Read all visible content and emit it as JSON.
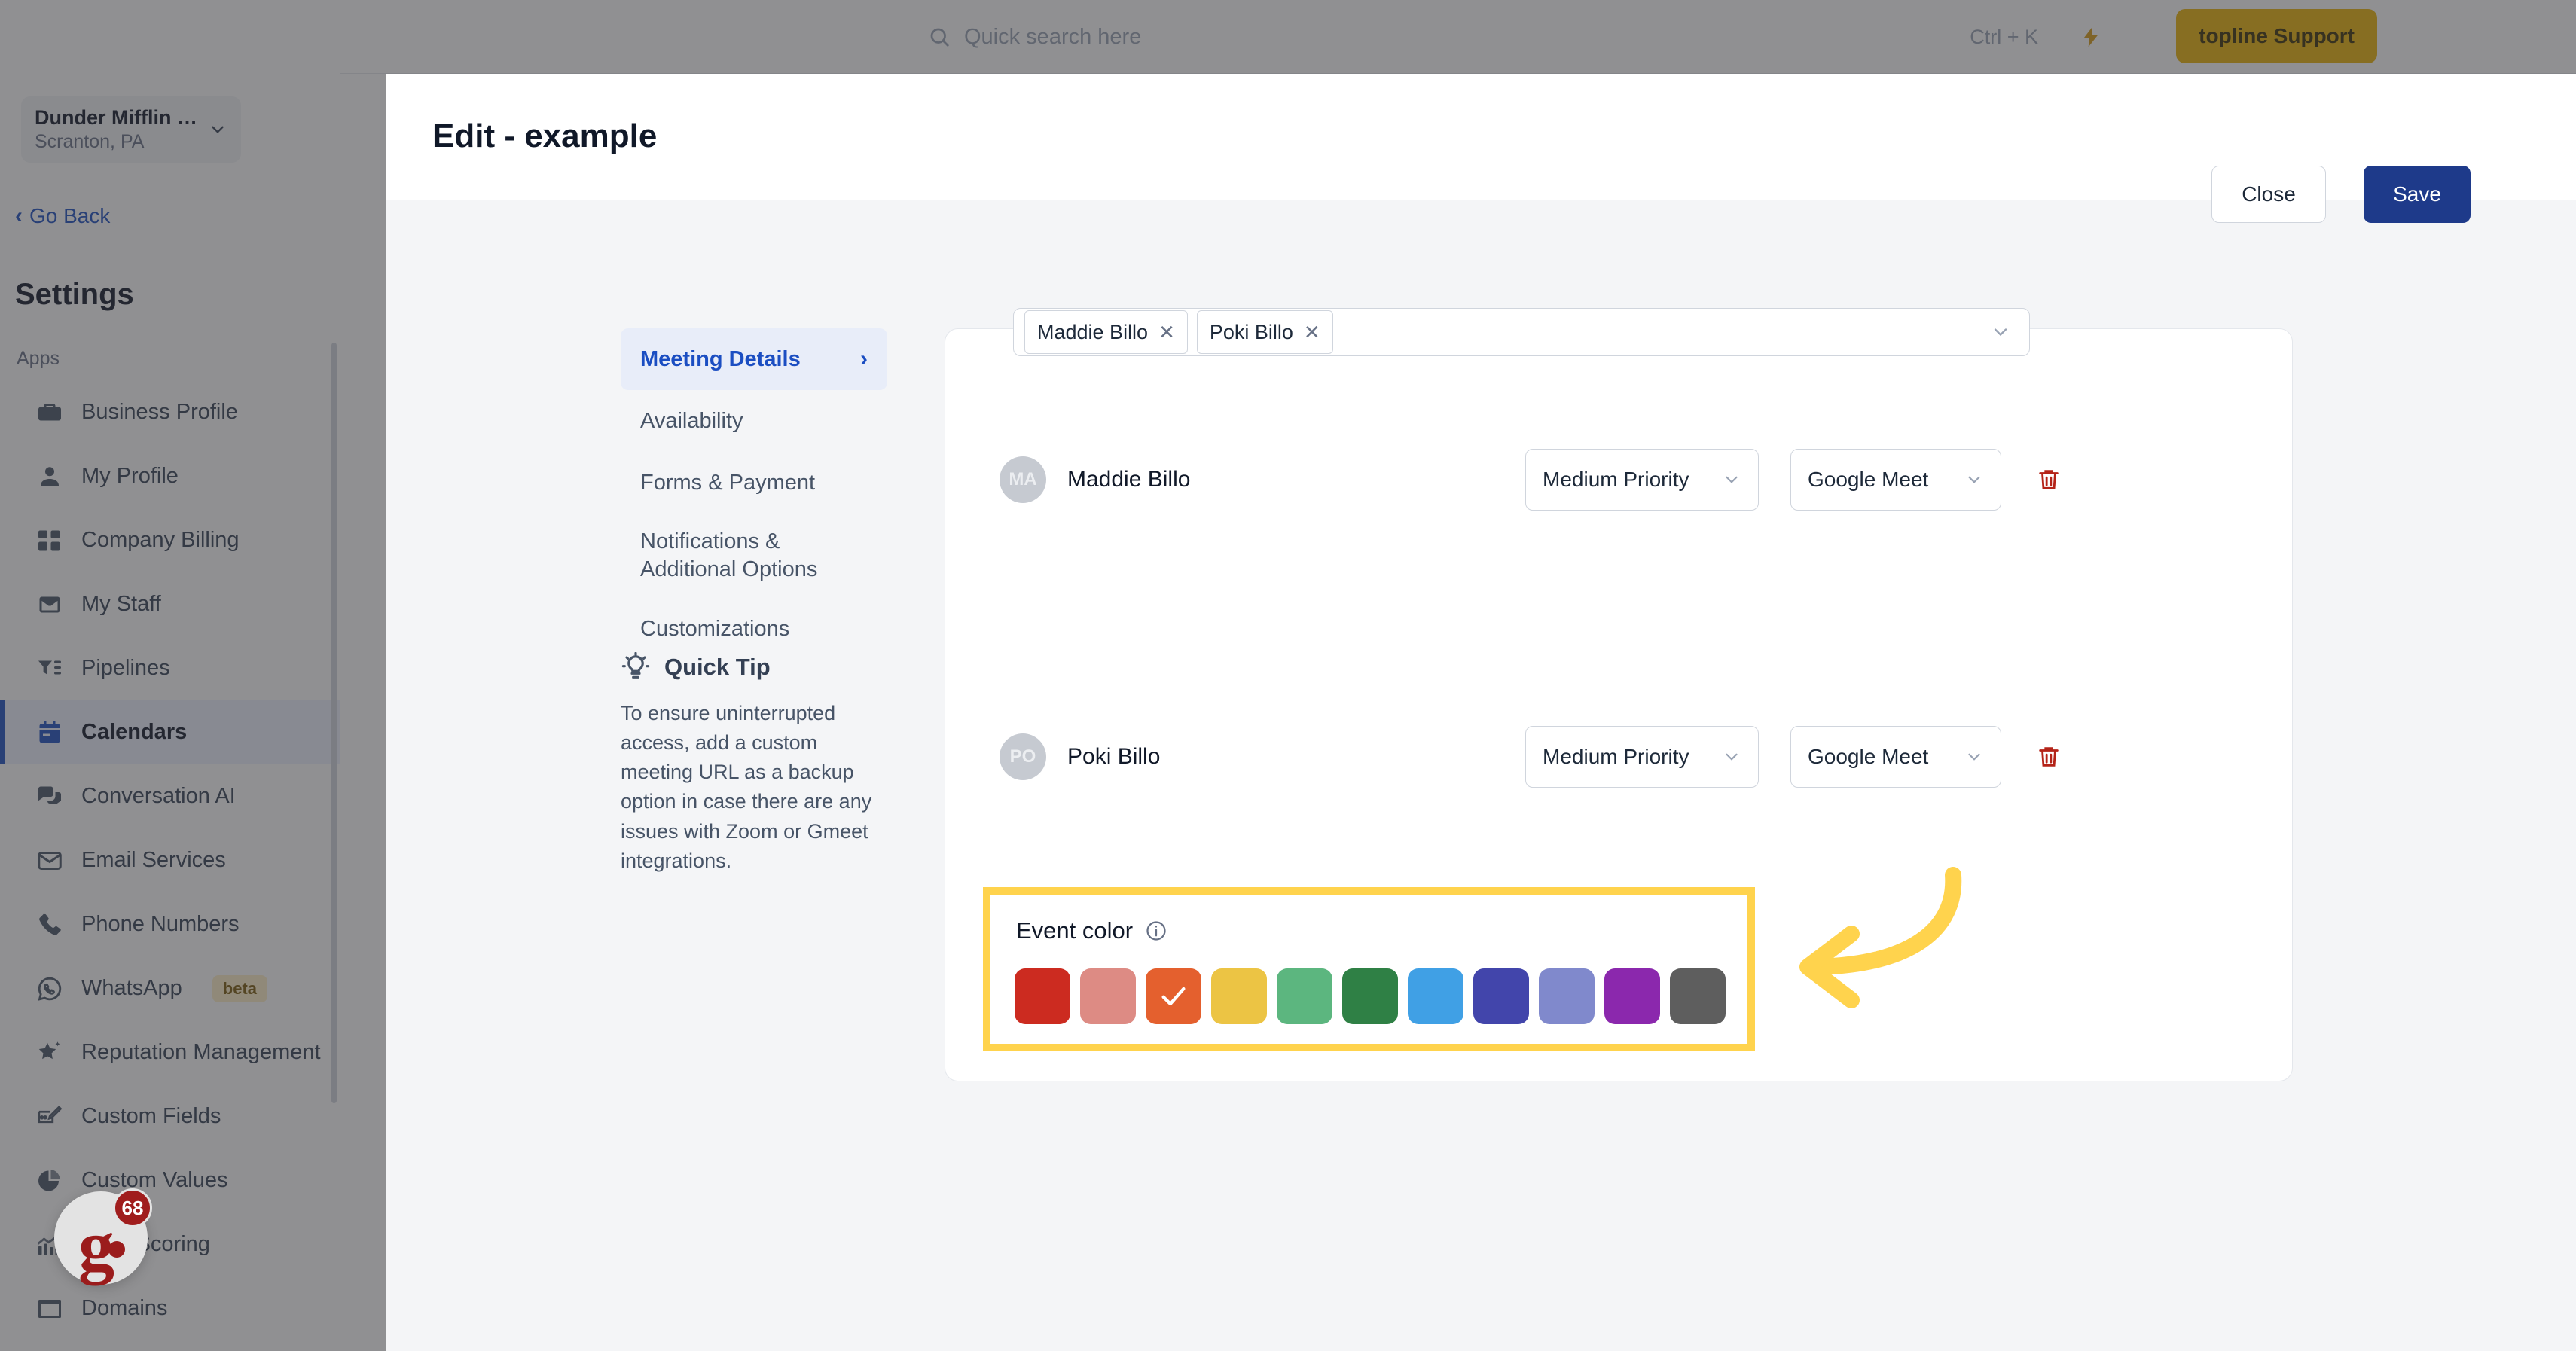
{
  "sidebar": {
    "location": {
      "name": "Dunder Mifflin [D...",
      "sub": "Scranton, PA"
    },
    "go_back": "Go Back",
    "settings_title": "Settings",
    "group_label": "Apps",
    "items": [
      {
        "label": "Business Profile",
        "icon": "briefcase-icon",
        "active": false
      },
      {
        "label": "My Profile",
        "icon": "user-icon",
        "active": false
      },
      {
        "label": "Company Billing",
        "icon": "calculator-icon",
        "active": false
      },
      {
        "label": "My Staff",
        "icon": "inbox-icon",
        "active": false
      },
      {
        "label": "Pipelines",
        "icon": "filter-icon",
        "active": false
      },
      {
        "label": "Calendars",
        "icon": "calendar-icon",
        "active": true
      },
      {
        "label": "Conversation AI",
        "icon": "chat-icon",
        "active": false
      },
      {
        "label": "Email Services",
        "icon": "envelope-icon",
        "active": false
      },
      {
        "label": "Phone Numbers",
        "icon": "phone-icon",
        "active": false
      },
      {
        "label": "WhatsApp",
        "icon": "whatsapp-icon",
        "active": false,
        "badge": "beta"
      },
      {
        "label": "Reputation Management",
        "icon": "star-icon",
        "active": false
      },
      {
        "label": "Custom Fields",
        "icon": "edit-field-icon",
        "active": false
      },
      {
        "label": "Custom Values",
        "icon": "pie-chart-icon",
        "active": false
      },
      {
        "label": "Lead Scoring",
        "icon": "chart-icon",
        "active": false
      },
      {
        "label": "Domains",
        "icon": "browser-icon",
        "active": false
      }
    ]
  },
  "support_widget": {
    "letter": "g",
    "count": "68"
  },
  "topbar": {
    "search_placeholder": "Quick search here",
    "search_value": "",
    "shortcut": "Ctrl + K",
    "support_label": "topline Support"
  },
  "modal": {
    "title": "Edit - example",
    "close_label": "Close",
    "save_label": "Save",
    "tabs": [
      {
        "label": "Meeting Details",
        "active": true
      },
      {
        "label": "Availability",
        "active": false
      },
      {
        "label": "Forms & Payment",
        "active": false
      },
      {
        "label": "Notifications & Additional Options",
        "active": false
      },
      {
        "label": "Customizations",
        "active": false
      }
    ],
    "quick_tip": {
      "title": "Quick Tip",
      "body": "To ensure uninterrupted access, add a custom meeting URL as a backup option in case there are any issues with Zoom or Gmeet integrations."
    },
    "assignee_chips": [
      {
        "label": "Maddie Billo"
      },
      {
        "label": "Poki Billo"
      }
    ],
    "members": [
      {
        "initials": "MA",
        "name": "Maddie Billo",
        "priority": "Medium Priority",
        "meeting": "Google Meet"
      },
      {
        "initials": "PO",
        "name": "Poki Billo",
        "priority": "Medium Priority",
        "meeting": "Google Meet"
      }
    ],
    "event_color": {
      "label": "Event color",
      "selected_index": 2,
      "swatches": [
        {
          "name": "red",
          "hex": "#cc2b20"
        },
        {
          "name": "salmon",
          "hex": "#dd8b84"
        },
        {
          "name": "orange",
          "hex": "#e4602e"
        },
        {
          "name": "yellow",
          "hex": "#ecc444"
        },
        {
          "name": "light-green",
          "hex": "#5cb67f"
        },
        {
          "name": "dark-green",
          "hex": "#2f8045"
        },
        {
          "name": "light-blue",
          "hex": "#40a0e5"
        },
        {
          "name": "indigo",
          "hex": "#4245ab"
        },
        {
          "name": "periwinkle",
          "hex": "#8089cc"
        },
        {
          "name": "purple",
          "hex": "#8b28ad"
        },
        {
          "name": "gray",
          "hex": "#5e5e5e"
        }
      ]
    }
  },
  "annotation": {
    "highlight_color": "#ffd34d",
    "arrow_color": "#ffd34d"
  }
}
